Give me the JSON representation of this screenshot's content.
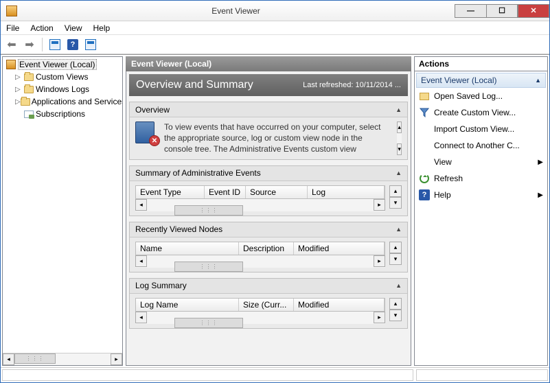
{
  "window": {
    "title": "Event Viewer"
  },
  "menu": {
    "file": "File",
    "action": "Action",
    "view": "View",
    "help": "Help"
  },
  "tree": {
    "root": "Event Viewer (Local)",
    "items": [
      {
        "label": "Custom Views"
      },
      {
        "label": "Windows Logs"
      },
      {
        "label": "Applications and Services Logs"
      },
      {
        "label": "Subscriptions"
      }
    ]
  },
  "center": {
    "header": "Event Viewer (Local)",
    "banner_title": "Overview and Summary",
    "last_refreshed": "Last refreshed: 10/11/2014 ...",
    "overview": {
      "title": "Overview",
      "text": "To view events that have occurred on your computer, select the appropriate source, log or custom view node in the console tree. The Administrative Events custom view"
    },
    "summary": {
      "title": "Summary of Administrative Events",
      "cols": [
        "Event Type",
        "Event ID",
        "Source",
        "Log"
      ]
    },
    "recent": {
      "title": "Recently Viewed Nodes",
      "cols": [
        "Name",
        "Description",
        "Modified"
      ]
    },
    "logsummary": {
      "title": "Log Summary",
      "cols": [
        "Log Name",
        "Size (Curr...",
        "Modified"
      ]
    }
  },
  "actions": {
    "header": "Actions",
    "group": "Event Viewer (Local)",
    "items": [
      "Open Saved Log...",
      "Create Custom View...",
      "Import Custom View...",
      "Connect to Another C...",
      "View",
      "Refresh",
      "Help"
    ]
  }
}
